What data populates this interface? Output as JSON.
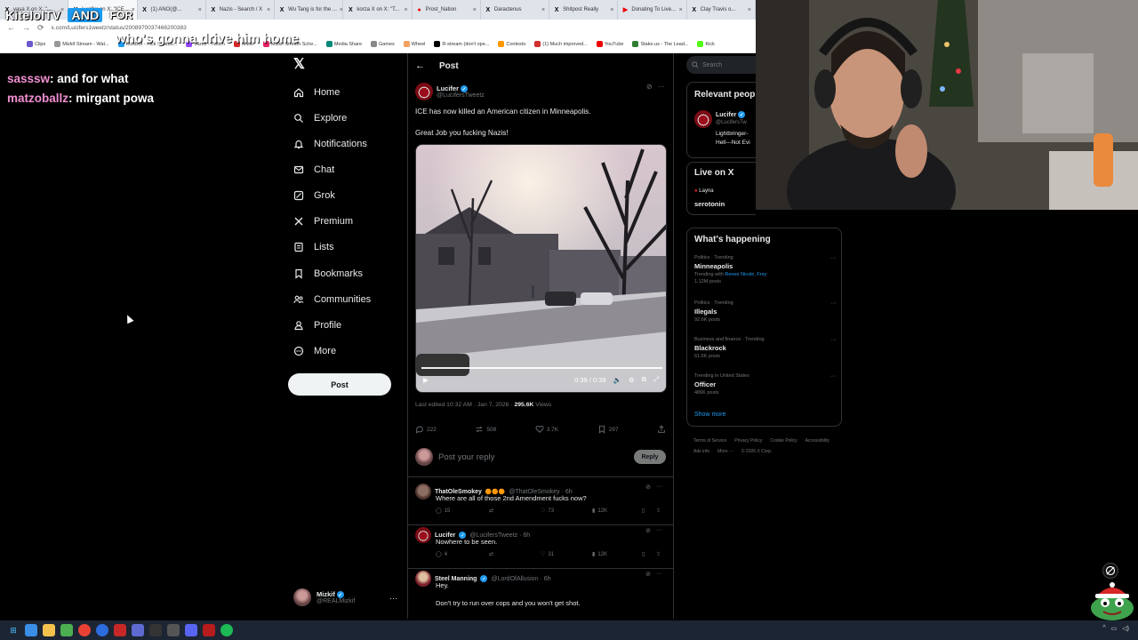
{
  "browser": {
    "tabs": [
      {
        "label": "vasa X on X: \"...",
        "favicon": "x-icon",
        "active": false
      },
      {
        "label": "Lucifer on X: \"ICE...",
        "favicon": "x-icon",
        "active": true
      },
      {
        "label": "(1) ANO(@...",
        "favicon": "x-icon",
        "active": false
      },
      {
        "label": "Nazis - Search / X",
        "favicon": "x-icon",
        "active": false
      },
      {
        "label": "Wu Tang is for the ...",
        "favicon": "x-icon",
        "active": false
      },
      {
        "label": "korza X on X: \"T...",
        "favicon": "x-icon",
        "active": false
      },
      {
        "label": "Prost_Nation",
        "favicon": "red-dot-icon",
        "active": false
      },
      {
        "label": "Daractenus",
        "favicon": "x-icon",
        "active": false
      },
      {
        "label": "Shitpost Really",
        "favicon": "x-icon",
        "active": false
      },
      {
        "label": "Donating To Live...",
        "favicon": "youtube-icon",
        "active": false
      },
      {
        "label": "Clay Travis o...",
        "favicon": "x-icon",
        "active": false
      }
    ],
    "url": "x.com/Lucifers1weetz/status/2008970037466200383",
    "bookmarks": [
      "Clips",
      "Mizkif Stream - Wat...",
      "KickBot - Kick Chatbo...",
      "Mizkif - Twitch",
      "Mizkif",
      "Mizkif Stream Sche...",
      "Media Share",
      "Games",
      "Wheel",
      "R-stream (don't ope...",
      "Contexto",
      "(1) Much improved...",
      "YouTube",
      "Stake.us - The Lead...",
      "Kick"
    ]
  },
  "stream": {
    "title_left": "KiteloITV",
    "title_and": "AND",
    "title_for": "FOR",
    "overlay": "who's gonna drive him home",
    "chat": [
      {
        "user": "sasssw",
        "message": "and for what"
      },
      {
        "user": "matzoballz",
        "message": "mirgant powa"
      }
    ]
  },
  "nav": {
    "items": [
      {
        "label": "Home",
        "icon": "home-icon"
      },
      {
        "label": "Explore",
        "icon": "search-icon"
      },
      {
        "label": "Notifications",
        "icon": "bell-icon"
      },
      {
        "label": "Chat",
        "icon": "mail-icon"
      },
      {
        "label": "Grok",
        "icon": "grok-icon"
      },
      {
        "label": "Premium",
        "icon": "x-icon"
      },
      {
        "label": "Lists",
        "icon": "list-icon"
      },
      {
        "label": "Bookmarks",
        "icon": "bookmark-icon"
      },
      {
        "label": "Communities",
        "icon": "people-icon"
      },
      {
        "label": "Profile",
        "icon": "person-icon"
      },
      {
        "label": "More",
        "icon": "more-circle-icon"
      }
    ],
    "post_label": "Post",
    "account": {
      "name": "Mizkif",
      "handle": "@REALMizkif"
    }
  },
  "post": {
    "header": "Post",
    "author": {
      "name": "Lucifer",
      "handle": "@LucifersTweetz"
    },
    "text_line1": "ICE has now killed an American citizen in Minneapolis.",
    "text_line2": "Great Job you fucking Nazis!",
    "video_time": "0:39 / 0:39",
    "video_progress": 1.0,
    "edited": "Last edited 10:32 AM · Jan 7, 2026 ·",
    "views": "295.6K",
    "views_label": "Views",
    "stats": {
      "replies": "222",
      "reposts": "508",
      "likes": "3.7K",
      "bookmarks": "297"
    },
    "reply_placeholder": "Post your reply",
    "reply_button": "Reply"
  },
  "replies": [
    {
      "name": "ThatOleSmokey",
      "badges": "🟠🟠🟠",
      "handle": "@ThatOleSmokey · 6h",
      "text": "Where are all of those 2nd Amendment fucks now?",
      "text2": "",
      "replies": "15",
      "reposts": "",
      "likes": "73",
      "views": "12K"
    },
    {
      "name": "Lucifer",
      "badges": "",
      "handle": "@LucifersTweetz · 6h",
      "text": "Nowhere to be seen.",
      "text2": "",
      "replies": "4",
      "reposts": "",
      "likes": "31",
      "views": "12K"
    },
    {
      "name": "Steel Manning",
      "badges": "",
      "handle": "@LordOfAllusion · 6h",
      "text": "Hey.",
      "text2": "Don't try to run over cops and you won't get shot.",
      "replies": "",
      "reposts": "",
      "likes": "",
      "views": ""
    }
  ],
  "sidebar": {
    "search_placeholder": "Search",
    "relevant_title": "Relevant peop",
    "relevant_person": {
      "name": "Lucifer",
      "handle": "@LucifersTw",
      "bio1": "Lightbringer-",
      "bio2": "Hell---Not Evi"
    },
    "live_title": "Live on X",
    "live_host": "Layna",
    "live_topic": "serotonin",
    "happening_title": "What's happening",
    "trends": [
      {
        "meta": "Politics · Trending",
        "name": "Minneapolis",
        "with": "Trending with",
        "with_link": "Renee Nicole, Frey",
        "posts": "1.12M posts"
      },
      {
        "meta": "Politics · Trending",
        "name": "Illegals",
        "with": "",
        "with_link": "",
        "posts": "92.6K posts"
      },
      {
        "meta": "Business and finance · Trending",
        "name": "Blackrock",
        "with": "",
        "with_link": "",
        "posts": "61.5K posts"
      },
      {
        "meta": "Trending in United States",
        "name": "Officer",
        "with": "",
        "with_link": "",
        "posts": "486K posts"
      }
    ],
    "show_more": "Show more",
    "footer": [
      "Terms of Service",
      "Privacy Policy",
      "Cookie Policy",
      "Accessibility",
      "Ads info",
      "More ···",
      "© 2026 X Corp."
    ]
  },
  "colors": {
    "accent": "#1d9bf0",
    "chat_user": "#f18fd1",
    "background": "#000000"
  }
}
